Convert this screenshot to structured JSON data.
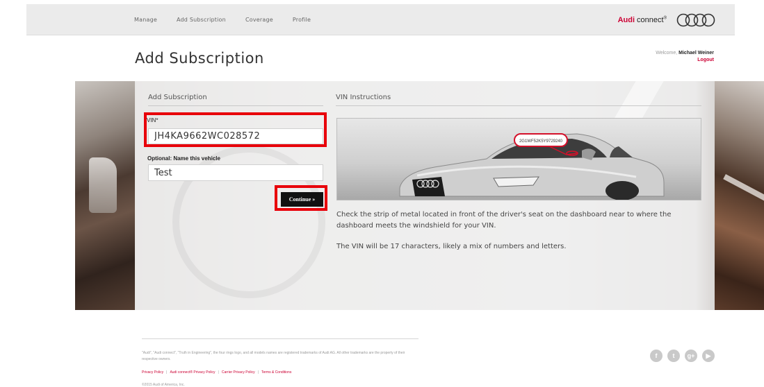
{
  "nav": {
    "items": [
      "Manage",
      "Add Subscription",
      "Coverage",
      "Profile"
    ]
  },
  "brand": {
    "audi": "Audi",
    "connect": "connect",
    "reg": "®",
    "logo": "four-rings-icon",
    "accent": "#cc0033"
  },
  "header": {
    "title": "Add Subscription",
    "welcome_prefix": "Welcome, ",
    "user_name": "Michael Weiner",
    "logout": "Logout"
  },
  "form": {
    "heading": "Add Subscription",
    "vin_label": "VIN*",
    "vin_value": "JH4KA9662WC028572",
    "name_label": "Optional: Name this vehicle",
    "name_value": "Test",
    "continue_label": "Continue  »",
    "highlight_color": "#e8000a"
  },
  "instructions": {
    "heading": "VIN Instructions",
    "vin_tag": "2G1WF52K5Y9729240",
    "para1": "Check the strip of metal located in front of the driver's seat on the dashboard near to where the dashboard meets the windshield for your VIN.",
    "para2": "The VIN will be 17 characters, likely a mix of numbers and letters."
  },
  "footer": {
    "legal": "\"Audi\", \"Audi connect\", \"Truth in Engineering\", the four rings logo, and all models names are registered trademarks of Audi AG. All other trademarks are the property of their respective owners.",
    "links": [
      "Privacy Policy",
      "Audi connect® Privacy Policy",
      "Carrier Privacy Policy",
      "Terms & Conditions"
    ],
    "copyright": "©2015 Audi of America, Inc.",
    "social": [
      {
        "icon": "facebook-icon",
        "glyph": "f"
      },
      {
        "icon": "twitter-icon",
        "glyph": "t"
      },
      {
        "icon": "google-plus-icon",
        "glyph": "g+"
      },
      {
        "icon": "youtube-icon",
        "glyph": "▶"
      }
    ]
  }
}
